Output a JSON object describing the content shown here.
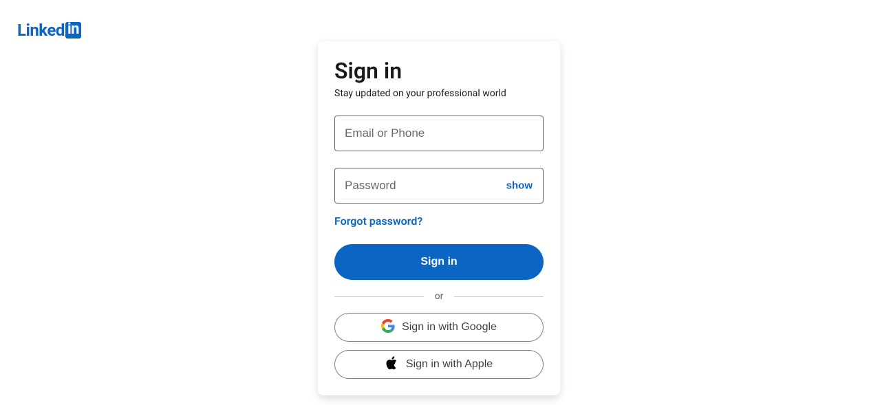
{
  "logo": {
    "text": "Linked",
    "in": "in"
  },
  "card": {
    "title": "Sign in",
    "subtitle": "Stay updated on your professional world",
    "email_placeholder": "Email or Phone",
    "email_value": "",
    "password_placeholder": "Password",
    "password_value": "",
    "show_label": "show",
    "forgot_label": "Forgot password?",
    "signin_label": "Sign in",
    "divider_label": "or",
    "google_label": "Sign in with Google",
    "apple_label": "Sign in with Apple"
  }
}
